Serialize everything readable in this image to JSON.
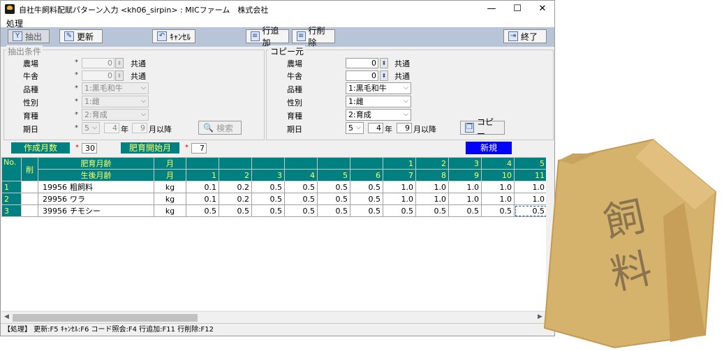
{
  "window": {
    "title": "自社牛飼料配賦パターン入力 <kh06_sirpin> : MICファーム　株式会社",
    "minimize": "—",
    "maximize": "☐",
    "close": "✕"
  },
  "menu": {
    "process": "処理"
  },
  "toolbar": {
    "extract": "抽出",
    "update": "更新",
    "cancel": "ｷｬﾝｾﾙ",
    "add_row": "行追加",
    "delete_row": "行削除",
    "exit": "終了"
  },
  "extract_conditions": {
    "title": "抽出条件",
    "farm_label": "農場",
    "farm_value": "0",
    "farm_common": "共通",
    "barn_label": "牛舎",
    "barn_value": "0",
    "barn_common": "共通",
    "breed_label": "品種",
    "breed_value": "1:黒毛和牛",
    "sex_label": "性別",
    "sex_value": "1:雌",
    "raising_label": "育種",
    "raising_value": "2:育成",
    "date_label": "期日",
    "date_day": "5",
    "date_year": "4",
    "year_unit": "年",
    "date_month": "9",
    "month_suffix": "月以降",
    "search": "検索"
  },
  "copy_source": {
    "title": "コピー元",
    "farm_label": "農場",
    "farm_value": "0",
    "farm_common": "共通",
    "barn_label": "牛舎",
    "barn_value": "0",
    "barn_common": "共通",
    "breed_label": "品種",
    "breed_value": "1:黒毛和牛",
    "sex_label": "性別",
    "sex_value": "1:雌",
    "raising_label": "育種",
    "raising_value": "2:育成",
    "date_label": "期日",
    "date_day": "5",
    "date_year": "4",
    "year_unit": "年",
    "date_month": "9",
    "month_suffix": "月以降",
    "copy_button": "コピー"
  },
  "params": {
    "months_label": "作成月数",
    "months_value": "30",
    "fattening_start_label": "肥育開始月",
    "fattening_start_value": "7",
    "new_button": "新規"
  },
  "grid": {
    "no_header": "No.",
    "del_header": "削",
    "fattening_age_header": "肥育月齢",
    "age_after_birth_header": "生後月齢",
    "unit_header_top": "月",
    "unit_header_bottom": "月",
    "fattening_ages": [
      "",
      "",
      "",
      "",
      "",
      "",
      "1",
      "2",
      "3",
      "4",
      "5"
    ],
    "birth_ages": [
      "1",
      "2",
      "3",
      "4",
      "5",
      "6",
      "7",
      "8",
      "9",
      "10",
      "11"
    ],
    "rows": [
      {
        "no": "1",
        "code": "19956",
        "name": "粗飼料",
        "unit": "kg",
        "values": [
          "0.1",
          "0.2",
          "0.5",
          "0.5",
          "0.5",
          "0.5",
          "1.0",
          "1.0",
          "1.0",
          "1.0",
          "1.0"
        ]
      },
      {
        "no": "2",
        "code": "29956",
        "name": "ワラ",
        "unit": "kg",
        "values": [
          "0.1",
          "0.2",
          "0.5",
          "0.5",
          "0.5",
          "0.5",
          "1.0",
          "1.0",
          "1.0",
          "1.0",
          "1.0"
        ]
      },
      {
        "no": "3",
        "code": "39956",
        "name": "チモシー",
        "unit": "kg",
        "values": [
          "0.5",
          "0.5",
          "0.5",
          "0.5",
          "0.5",
          "0.5",
          "0.5",
          "0.5",
          "0.5",
          "0.5",
          "0.5"
        ]
      }
    ]
  },
  "statusbar": {
    "text": "【処理】 更新:F5  ｷｬﾝｾﾙ:F6  コード照会:F4  行追加:F11  行削除:F12"
  },
  "illustration": {
    "text1": "飼",
    "text2": "料",
    "bag_color": "#d9b56f",
    "bag_dark": "#c49a52"
  }
}
